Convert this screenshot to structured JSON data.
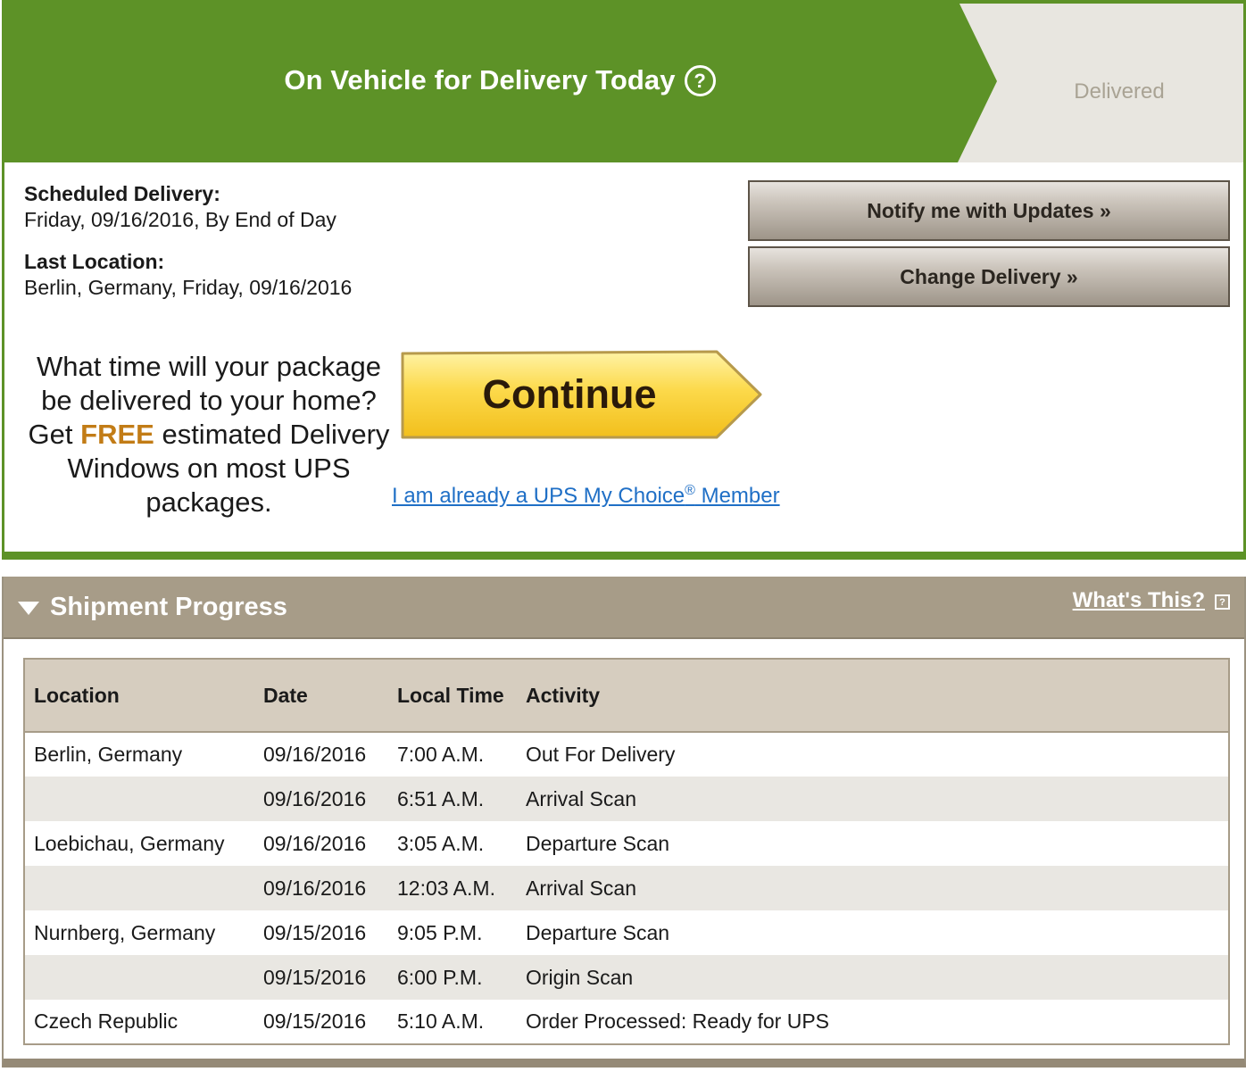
{
  "status": {
    "current": "On Vehicle for Delivery Today",
    "help_icon": "question-circle-icon",
    "next": "Delivered",
    "colors": {
      "active": "#5d9227",
      "inactive": "#e8e6e0"
    }
  },
  "delivery": {
    "scheduled_label": "Scheduled Delivery:",
    "scheduled_value": "Friday, 09/16/2016, By End of Day",
    "last_location_label": "Last Location:",
    "last_location_value": "Berlin, Germany, Friday, 09/16/2016"
  },
  "actions": {
    "notify": "Notify me with Updates »",
    "change": "Change Delivery »"
  },
  "promo": {
    "line1": "What time will your package be delivered to your home?",
    "get": "Get",
    "free": "FREE",
    "line2": "estimated Delivery Windows on most UPS packages.",
    "continue": "Continue",
    "member_link_pre": "I am already a UPS My Choice",
    "member_link_reg": "®",
    "member_link_post": " Member"
  },
  "shipment": {
    "title": "Shipment Progress",
    "whats_this": "What's This?",
    "info_icon": "info-square-icon",
    "headers": [
      "Location",
      "Date",
      "Local Time",
      "Activity"
    ],
    "rows": [
      {
        "location": "Berlin, Germany",
        "date": "09/16/2016",
        "time": "7:00 A.M.",
        "activity": "Out For Delivery"
      },
      {
        "location": "",
        "date": "09/16/2016",
        "time": "6:51 A.M.",
        "activity": "Arrival Scan"
      },
      {
        "location": "Loebichau, Germany",
        "date": "09/16/2016",
        "time": "3:05 A.M.",
        "activity": "Departure Scan"
      },
      {
        "location": "",
        "date": "09/16/2016",
        "time": "12:03 A.M.",
        "activity": "Arrival Scan"
      },
      {
        "location": "Nurnberg, Germany",
        "date": "09/15/2016",
        "time": "9:05 P.M.",
        "activity": "Departure Scan"
      },
      {
        "location": "",
        "date": "09/15/2016",
        "time": "6:00 P.M.",
        "activity": "Origin Scan"
      },
      {
        "location": "Czech Republic",
        "date": "09/15/2016",
        "time": "5:10 A.M.",
        "activity": "Order Processed: Ready for UPS"
      }
    ]
  }
}
